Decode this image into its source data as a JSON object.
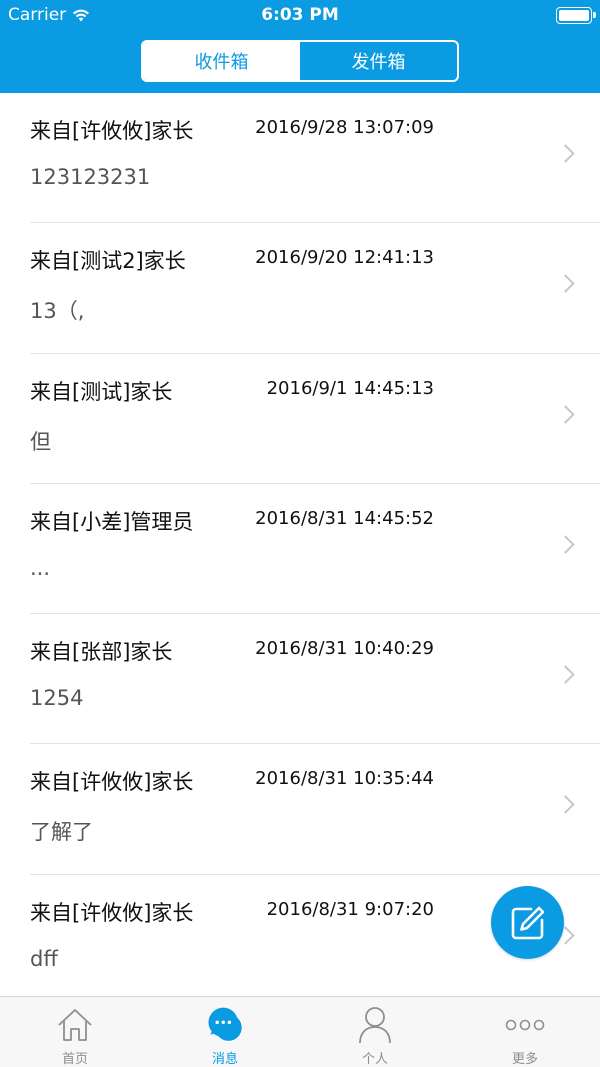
{
  "status_bar": {
    "carrier": "Carrier",
    "time": "6:03 PM"
  },
  "segmented": {
    "inbox": "收件箱",
    "outbox": "发件箱"
  },
  "messages": [
    {
      "sender": "来自[许攸攸]家长",
      "date": "2016/9/28 13:07:09",
      "preview": "123123231"
    },
    {
      "sender": "来自[测试2]家长",
      "date": "2016/9/20 12:41:13",
      "preview": "13（,"
    },
    {
      "sender": "来自[测试]家长",
      "date": "2016/9/1 14:45:13",
      "preview": "但"
    },
    {
      "sender": "来自[小差]管理员",
      "date": "2016/8/31 14:45:52",
      "preview": "..."
    },
    {
      "sender": "来自[张部]家长",
      "date": "2016/8/31 10:40:29",
      "preview": "1254"
    },
    {
      "sender": "来自[许攸攸]家长",
      "date": "2016/8/31 10:35:44",
      "preview": "了解了"
    },
    {
      "sender": "来自[许攸攸]家长",
      "date": "2016/8/31 9:07:20",
      "preview": "dff"
    }
  ],
  "tabbar": {
    "home": "首页",
    "messages": "消息",
    "profile": "个人",
    "more": "更多"
  },
  "colors": {
    "accent": "#0a9be3",
    "tab_inactive": "#8e8e93"
  },
  "icons": {
    "home": "home-icon",
    "messages": "chat-bubble-icon",
    "profile": "person-icon",
    "more": "more-dots-icon",
    "compose": "compose-icon"
  }
}
